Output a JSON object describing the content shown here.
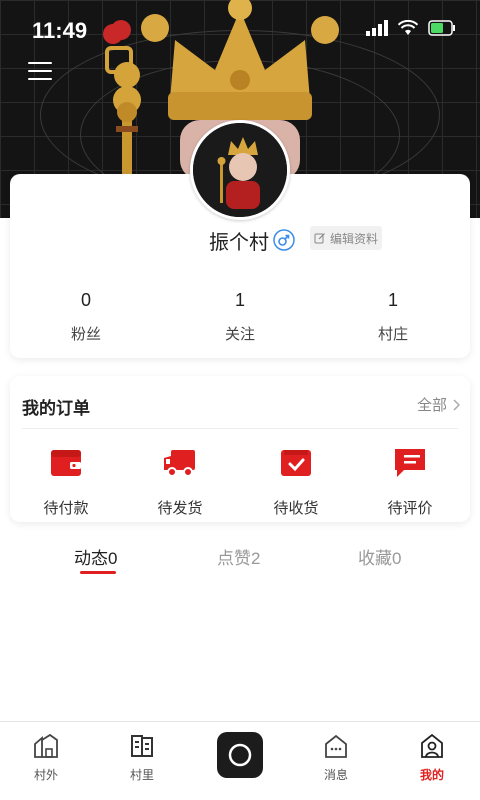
{
  "status_bar": {
    "time": "11:49"
  },
  "profile": {
    "username": "振个村",
    "edit_label": "编辑资料",
    "stats": [
      {
        "value": "0",
        "label": "粉丝"
      },
      {
        "value": "1",
        "label": "关注"
      },
      {
        "value": "1",
        "label": "村庄"
      }
    ]
  },
  "orders": {
    "title": "我的订单",
    "all_label": "全部",
    "items": [
      {
        "label": "待付款",
        "icon": "wallet-icon"
      },
      {
        "label": "待发货",
        "icon": "truck-icon"
      },
      {
        "label": "待收货",
        "icon": "received-box-icon"
      },
      {
        "label": "待评价",
        "icon": "review-icon"
      }
    ]
  },
  "tabs": [
    {
      "label": "动态0",
      "active": true
    },
    {
      "label": "点赞2",
      "active": false
    },
    {
      "label": "收藏0",
      "active": false
    }
  ],
  "bottom_nav": [
    {
      "label": "村外",
      "icon": "village-outside-icon",
      "active": false
    },
    {
      "label": "村里",
      "icon": "village-inside-icon",
      "active": false
    },
    {
      "label": "消息",
      "icon": "message-house-icon",
      "active": false
    },
    {
      "label": "我的",
      "icon": "profile-house-icon",
      "active": true
    }
  ],
  "colors": {
    "accent": "#e02020",
    "header_bg": "#141414",
    "text_primary": "#222222",
    "text_secondary": "#888888"
  }
}
